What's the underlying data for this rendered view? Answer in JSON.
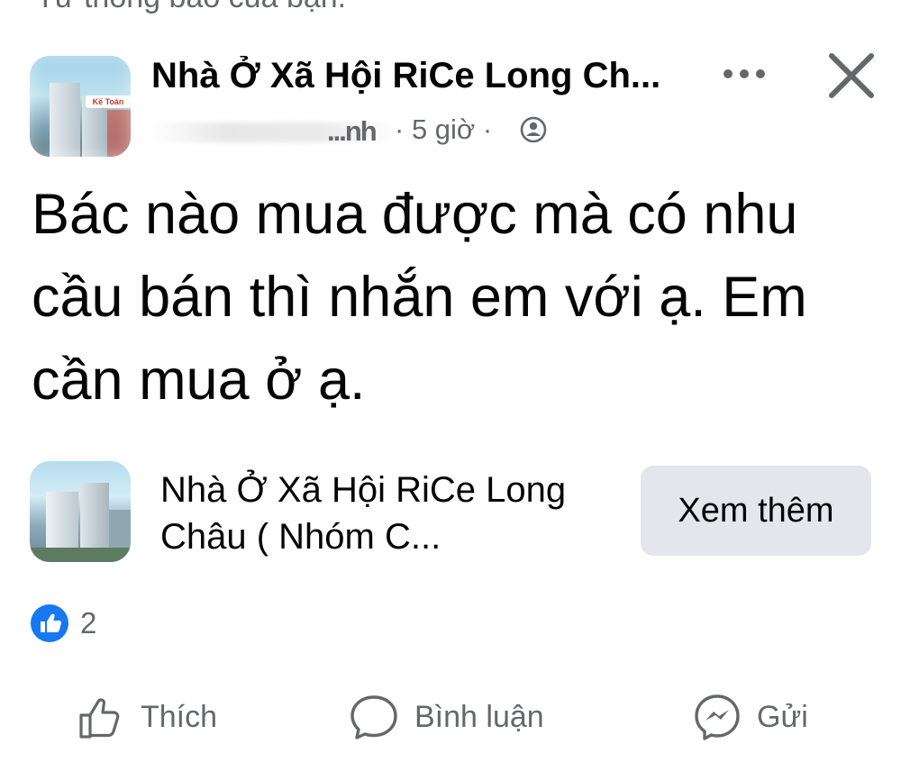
{
  "top_cut_text": "Từ thông báo của bạn.",
  "post": {
    "group_name": "Nhà Ở Xã Hội RiCe Long Ch...",
    "author_tail": "...nh",
    "time": "5 giờ",
    "separator": "·",
    "privacy_icon": "group-members-icon",
    "body": "Bác nào mua được mà có nhu cầu bán thì nhắn em với ạ. Em cần mua ở ạ."
  },
  "link_card": {
    "title": "Nhà Ở Xã Hội RiCe Long Châu ( Nhóm C...",
    "button_label": "Xem thêm"
  },
  "reactions": {
    "count": "2",
    "icon": "like-reaction-icon",
    "color": "#1877f2"
  },
  "actions": {
    "like_label": "Thích",
    "comment_label": "Bình luận",
    "send_label": "Gửi"
  },
  "colors": {
    "text_primary": "#050505",
    "text_secondary": "#65676b",
    "button_bg": "#e4e6eb",
    "brand_blue": "#1877f2"
  }
}
